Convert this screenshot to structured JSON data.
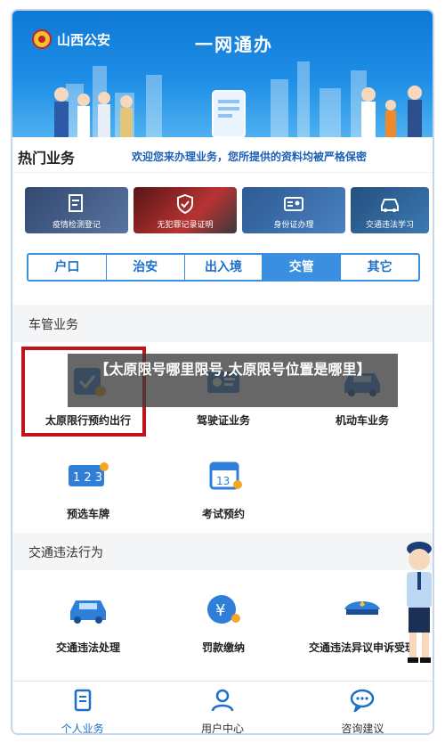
{
  "banner": {
    "org_name": "山西公安",
    "title": "一网通办"
  },
  "hot": {
    "title": "热门业务",
    "note": "欢迎您来办理业务，您所提供的资料均被严格保密"
  },
  "cards": [
    {
      "label": "疫情检测登记"
    },
    {
      "label": "无犯罪记录证明"
    },
    {
      "label": "身份证办理"
    },
    {
      "label": "交通违法学习"
    }
  ],
  "tabs": [
    {
      "label": "户口",
      "active": false
    },
    {
      "label": "治安",
      "active": false
    },
    {
      "label": "出入境",
      "active": false
    },
    {
      "label": "交管",
      "active": true
    },
    {
      "label": "其它",
      "active": false
    }
  ],
  "section_vehicle": {
    "title": "车管业务",
    "items": [
      {
        "label": "太原限行预约出行"
      },
      {
        "label": "驾驶证业务"
      },
      {
        "label": "机动车业务"
      },
      {
        "label": "预选车牌"
      },
      {
        "label": "考试预约"
      }
    ]
  },
  "section_violation": {
    "title": "交通违法行为",
    "items": [
      {
        "label": "交通违法处理"
      },
      {
        "label": "罚款缴纳"
      },
      {
        "label": "交通违法异议申诉受理"
      }
    ]
  },
  "overlay_caption": "【太原限号哪里限号,太原限号位置是哪里】",
  "bottom_nav": [
    {
      "label": "个人业务",
      "active": true
    },
    {
      "label": "用户中心",
      "active": false
    },
    {
      "label": "咨询建议",
      "active": false
    }
  ],
  "colors": {
    "primary": "#3a8fe0",
    "highlight_red": "#c0131a",
    "banner_blue": "#1e8ee6"
  }
}
